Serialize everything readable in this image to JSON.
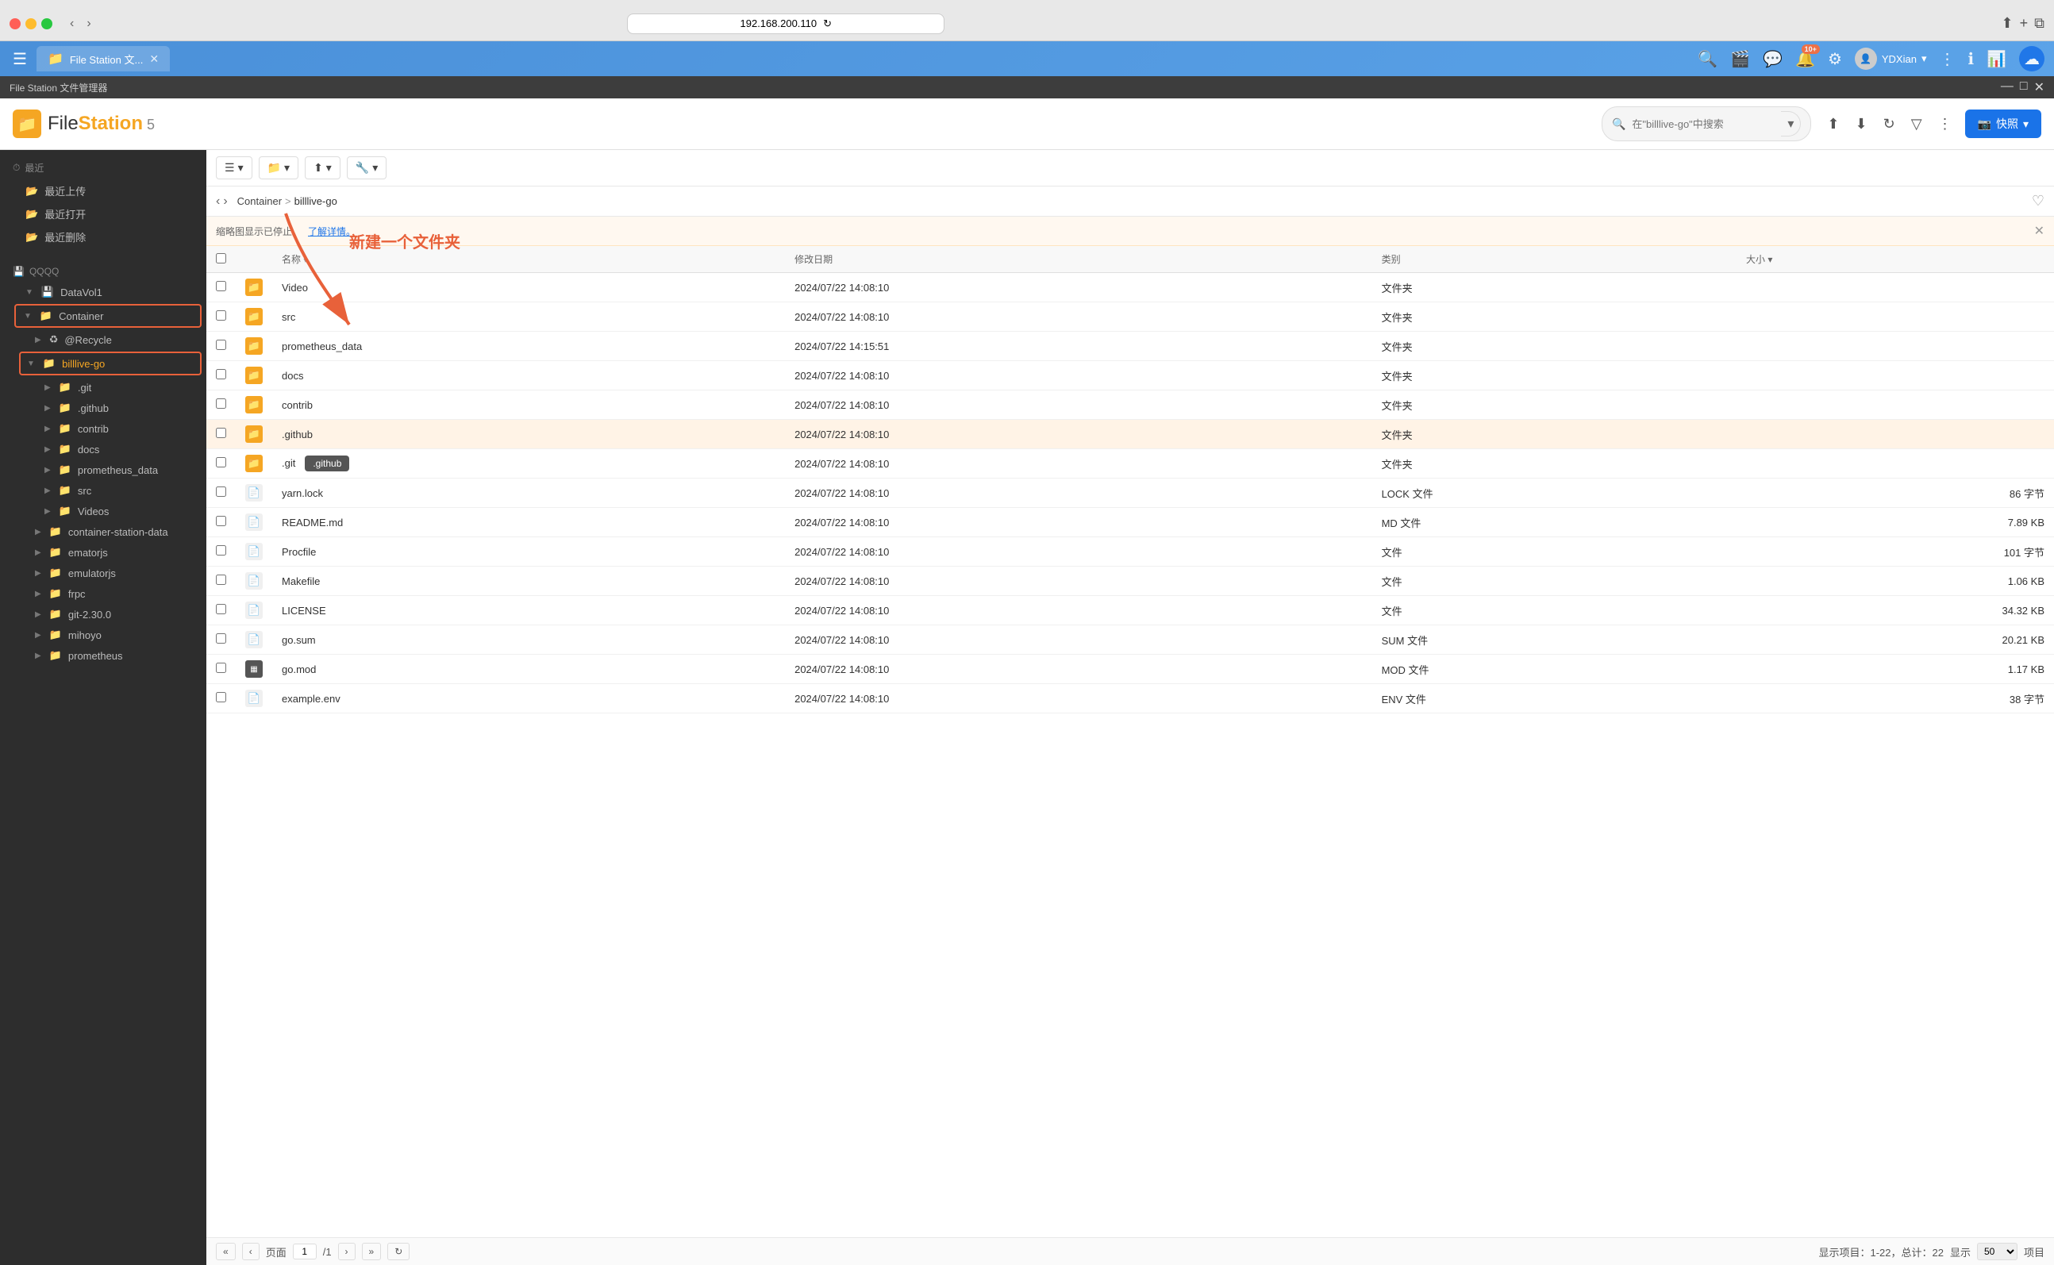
{
  "browser": {
    "address": "192.168.200.110",
    "reload_icon": "↻"
  },
  "titlebar": {
    "app_name": "File Station 文...",
    "title": "File Station 文件管理器",
    "minimize": "—",
    "maximize": "□",
    "close": "✕",
    "hamburger": "☰",
    "notifications_badge": "10+",
    "user_name": "YDXian",
    "snapshot_label": "快照"
  },
  "app": {
    "logo_icon": "📁",
    "title_file": "File",
    "title_station": "Station",
    "title_version": " 5"
  },
  "search": {
    "placeholder": "在\"billlive-go\"中搜索"
  },
  "toolbar": {
    "list_view": "☰",
    "new_folder": "📁",
    "upload": "⬆",
    "tools": "🔧",
    "view_list_label": "列表视图",
    "new_folder_label": "新建文件夹",
    "upload_label": "上传",
    "tools_label": "工具"
  },
  "breadcrumb": {
    "back": "‹",
    "forward": "›",
    "container": "Container",
    "separator": ">",
    "current": "billlive-go"
  },
  "notice": {
    "text": "缩略图显示已停止。",
    "link_text": "了解详情。"
  },
  "table": {
    "headers": {
      "name": "名称",
      "date": "修改日期",
      "type": "类别",
      "size": "大小"
    },
    "rows": [
      {
        "name": "Video",
        "date": "2024/07/22 14:08:10",
        "type": "文件夹",
        "size": "",
        "is_folder": true
      },
      {
        "name": "src",
        "date": "2024/07/22 14:08:10",
        "type": "文件夹",
        "size": "",
        "is_folder": true
      },
      {
        "name": "prometheus_data",
        "date": "2024/07/22 14:15:51",
        "type": "文件夹",
        "size": "",
        "is_folder": true
      },
      {
        "name": "docs",
        "date": "2024/07/22 14:08:10",
        "type": "文件夹",
        "size": "",
        "is_folder": true
      },
      {
        "name": "contrib",
        "date": "2024/07/22 14:08:10",
        "type": "文件夹",
        "size": "",
        "is_folder": true
      },
      {
        "name": ".github",
        "date": "2024/07/22 14:08:10",
        "type": "文件夹",
        "size": "",
        "is_folder": true,
        "highlighted": true
      },
      {
        "name": ".git",
        "date": "2024/07/22 14:08:10",
        "type": "文件夹",
        "size": "",
        "is_folder": true,
        "tooltip": ".github"
      },
      {
        "name": "yarn.lock",
        "date": "2024/07/22 14:08:10",
        "type": "LOCK 文件",
        "size": "86 字节",
        "is_folder": false
      },
      {
        "name": "README.md",
        "date": "2024/07/22 14:08:10",
        "type": "MD 文件",
        "size": "7.89 KB",
        "is_folder": false
      },
      {
        "name": "Procfile",
        "date": "2024/07/22 14:08:10",
        "type": "文件",
        "size": "101 字节",
        "is_folder": false
      },
      {
        "name": "Makefile",
        "date": "2024/07/22 14:08:10",
        "type": "文件",
        "size": "1.06 KB",
        "is_folder": false
      },
      {
        "name": "LICENSE",
        "date": "2024/07/22 14:08:10",
        "type": "文件",
        "size": "34.32 KB",
        "is_folder": false
      },
      {
        "name": "go.sum",
        "date": "2024/07/22 14:08:10",
        "type": "SUM 文件",
        "size": "20.21 KB",
        "is_folder": false
      },
      {
        "name": "go.mod",
        "date": "2024/07/22 14:08:10",
        "type": "MOD 文件",
        "size": "1.17 KB",
        "is_folder": false,
        "dark_icon": true
      },
      {
        "name": "example.env",
        "date": "2024/07/22 14:08:10",
        "type": "ENV 文件",
        "size": "38 字节",
        "is_folder": false
      }
    ]
  },
  "pagination": {
    "page_label": "页面",
    "page_current": "1",
    "page_total": "/1",
    "first": "«",
    "prev": "‹",
    "next": "›",
    "last": "»",
    "refresh": "↻",
    "display_label": "显示项目：1-22，总计：22",
    "show_label": "显示",
    "show_count": "50",
    "items_label": "项目"
  },
  "sidebar": {
    "recent_label": "最近",
    "recent_upload": "最近上传",
    "recent_open": "最近打开",
    "recent_delete": "最近删除",
    "qqqq_label": "QQQQ",
    "datavol1": "DataVol1",
    "container": "Container",
    "recycle": "@Recycle",
    "billlive_go": "billlive-go",
    "git": ".git",
    "github": ".github",
    "contrib_sub": "contrib",
    "docs_sub": "docs",
    "prometheus_data_sub": "prometheus_data",
    "src_sub": "src",
    "videos_sub": "Videos",
    "container_station": "container-station-data",
    "ematorjs": "ematorjs",
    "emulatorjs": "emulatorjs",
    "frpc": "frpc",
    "git_230": "git-2.30.0",
    "mihoyo": "mihoyo",
    "prometheus": "prometheus"
  },
  "annotation": {
    "text": "新建一个文件夹",
    "color": "#e8613a"
  },
  "colors": {
    "accent": "#f5a623",
    "blue": "#1a73e8",
    "dark_sidebar": "#2d2d2d",
    "highlight_row": "#fff3e6",
    "red_arrow": "#e8613a"
  }
}
